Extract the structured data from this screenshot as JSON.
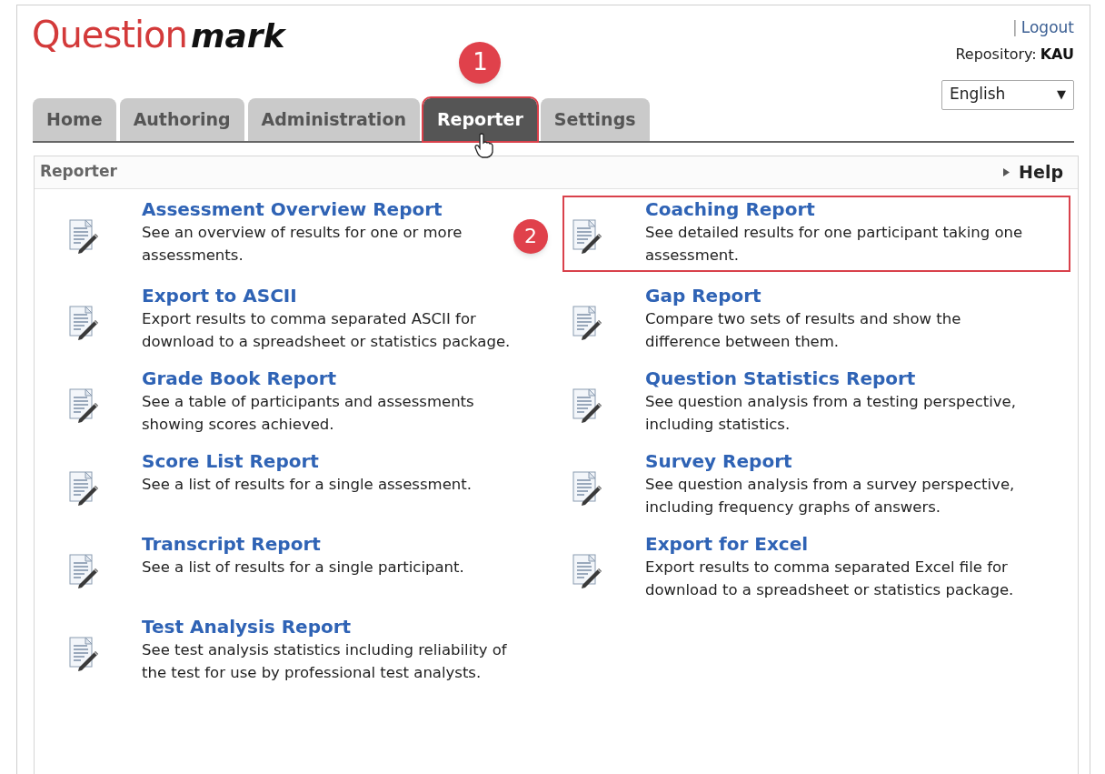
{
  "header": {
    "logo_regular": "Question",
    "logo_bold": "mark",
    "separator": "|",
    "logout": "Logout",
    "repository_label": "Repository:",
    "repository": "KAU",
    "language": "English",
    "dropdown_arrow": "▼"
  },
  "tabs": [
    {
      "label": "Home",
      "selected": false
    },
    {
      "label": "Authoring",
      "selected": false
    },
    {
      "label": "Administration",
      "selected": false
    },
    {
      "label": "Reporter",
      "selected": true,
      "callout": "1"
    },
    {
      "label": "Settings",
      "selected": false
    }
  ],
  "panel": {
    "title": "Reporter",
    "help": "Help"
  },
  "reports": [
    {
      "title": "Assessment Overview Report",
      "description": "See an overview of results for one or more assessments."
    },
    {
      "title": "Coaching Report",
      "description": "See detailed results for one participant taking one assessment.",
      "callout": "2"
    },
    {
      "title": "Export to ASCII",
      "description": "Export results to comma separated ASCII for download to a spreadsheet or statistics package."
    },
    {
      "title": "Gap Report",
      "description": "Compare two sets of results and show the difference between them."
    },
    {
      "title": "Grade Book Report",
      "description": "See a table of participants and assessments showing scores achieved."
    },
    {
      "title": "Question Statistics Report",
      "description": "See question analysis from a testing perspective, including statistics."
    },
    {
      "title": "Score List Report",
      "description": "See a list of results for a single assessment."
    },
    {
      "title": "Survey Report",
      "description": "See question analysis from a survey perspective, including frequency graphs of answers."
    },
    {
      "title": "Transcript Report",
      "description": "See a list of results for a single participant."
    },
    {
      "title": "Export for Excel",
      "description": "Export results to comma separated Excel file for download to a spreadsheet or statistics package."
    },
    {
      "title": "Test Analysis Report",
      "description": "See test analysis statistics including reliability of the test for use by professional test analysts."
    }
  ]
}
